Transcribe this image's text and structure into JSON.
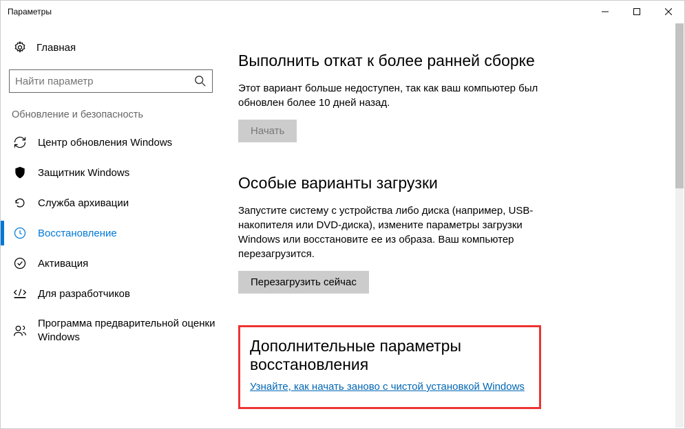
{
  "window": {
    "title": "Параметры"
  },
  "sidebar": {
    "home_label": "Главная",
    "search_placeholder": "Найти параметр",
    "group_header": "Обновление и безопасность",
    "items": [
      {
        "label": "Центр обновления Windows"
      },
      {
        "label": "Защитник Windows"
      },
      {
        "label": "Служба архивации"
      },
      {
        "label": "Восстановление"
      },
      {
        "label": "Активация"
      },
      {
        "label": "Для разработчиков"
      },
      {
        "label": "Программа предварительной оценки Windows"
      }
    ]
  },
  "content": {
    "rollback": {
      "title": "Выполнить откат к более ранней сборке",
      "text": "Этот вариант больше недоступен, так как ваш компьютер был обновлен более 10 дней назад.",
      "button": "Начать"
    },
    "advanced_startup": {
      "title": "Особые варианты загрузки",
      "text": "Запустите систему с устройства либо диска (например, USB-накопителя или DVD-диска), измените параметры загрузки Windows или восстановите ее из образа. Ваш компьютер перезагрузится.",
      "button": "Перезагрузить сейчас"
    },
    "more_recovery": {
      "title": "Дополнительные параметры восстановления",
      "link": "Узнайте, как начать заново с чистой установкой Windows"
    }
  }
}
